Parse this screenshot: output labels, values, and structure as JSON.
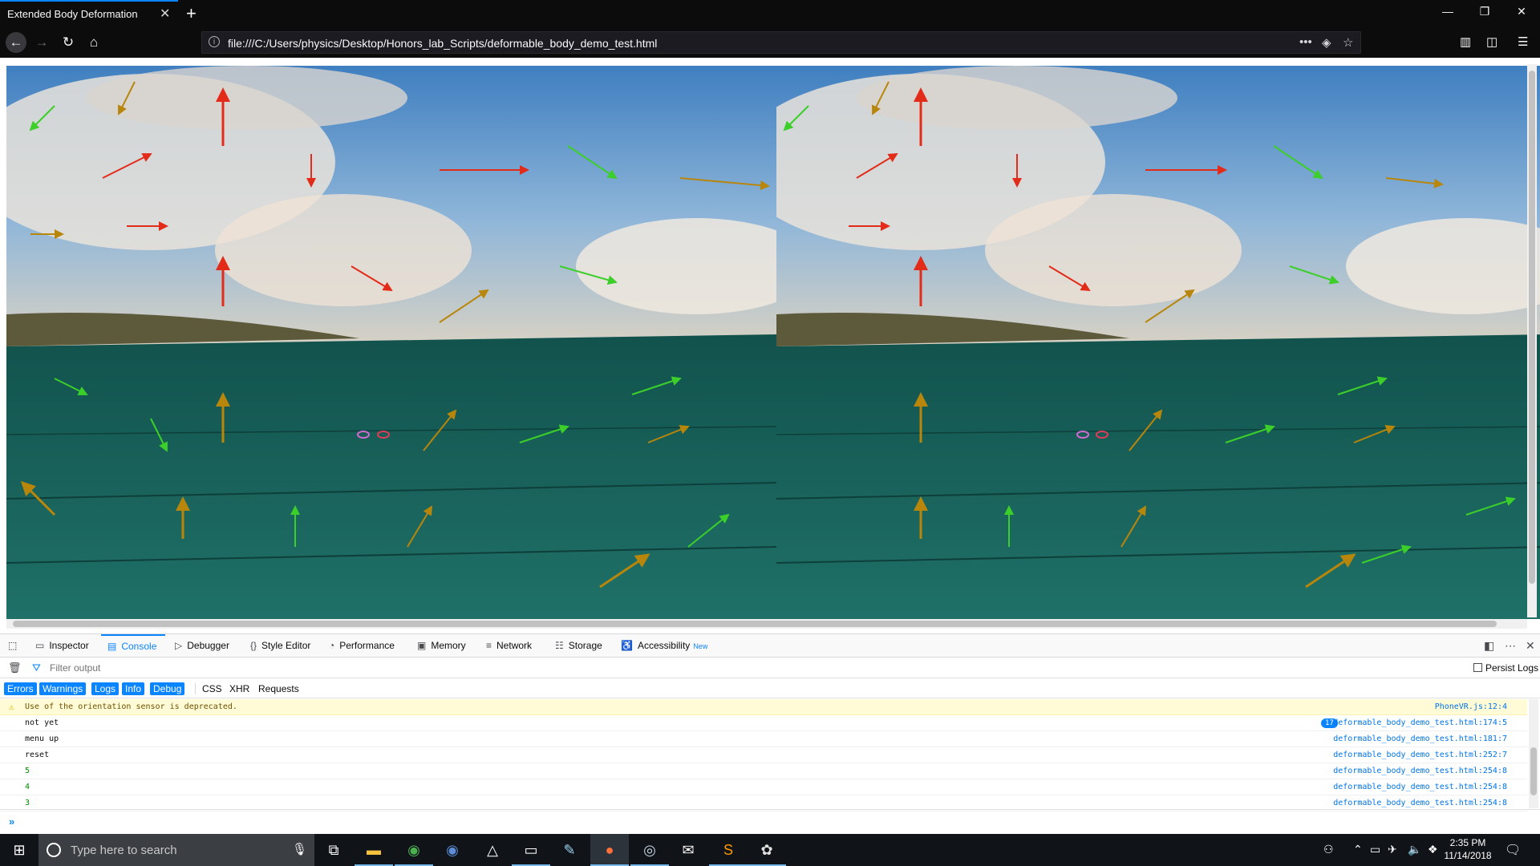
{
  "browser": {
    "tab_title": "Extended Body Deformation",
    "url": "file:///C:/Users/physics/Desktop/Honors_lab_Scripts/deformable_body_demo_test.html"
  },
  "devtools": {
    "tabs": [
      {
        "label": "Inspector",
        "icon": "inspector-icon"
      },
      {
        "label": "Console",
        "icon": "console-icon",
        "selected": true
      },
      {
        "label": "Debugger",
        "icon": "debugger-icon"
      },
      {
        "label": "Style Editor",
        "icon": "style-editor-icon"
      },
      {
        "label": "Performance",
        "icon": "performance-icon"
      },
      {
        "label": "Memory",
        "icon": "memory-icon"
      },
      {
        "label": "Network",
        "icon": "network-icon"
      },
      {
        "label": "Storage",
        "icon": "storage-icon"
      },
      {
        "label": "Accessibility",
        "icon": "accessibility-icon"
      }
    ],
    "accessibility_badge": "New",
    "filter_placeholder": "Filter output",
    "persist_logs_label": "Persist Logs",
    "levels": [
      {
        "label": "Errors",
        "on": true
      },
      {
        "label": "Warnings",
        "on": true
      },
      {
        "label": "Logs",
        "on": true
      },
      {
        "label": "Info",
        "on": true
      },
      {
        "label": "Debug",
        "on": true
      }
    ],
    "categories": [
      "CSS",
      "XHR",
      "Requests"
    ],
    "messages": [
      {
        "type": "warning",
        "text": "Use of the orientation sensor is deprecated.",
        "source": "PhoneVR.js:12:4"
      },
      {
        "type": "log",
        "text": "not yet",
        "source": "deformable_body_demo_test.html:174:5",
        "repeat": "17"
      },
      {
        "type": "log",
        "text": "menu up",
        "source": "deformable_body_demo_test.html:181:7"
      },
      {
        "type": "log",
        "text": "reset",
        "source": "deformable_body_demo_test.html:252:7"
      },
      {
        "type": "number",
        "text": "5",
        "source": "deformable_body_demo_test.html:254:8"
      },
      {
        "type": "number",
        "text": "4",
        "source": "deformable_body_demo_test.html:254:8"
      },
      {
        "type": "number",
        "text": "3",
        "source": "deformable_body_demo_test.html:254:8"
      }
    ],
    "prompt": "»"
  },
  "taskbar": {
    "search_placeholder": "Type here to search",
    "time": "2:35 PM",
    "date": "11/14/2018",
    "apps": [
      "task-view-icon",
      "file-explorer-icon",
      "chrome-icon",
      "chromium-icon",
      "drive-icon",
      "terminal-icon",
      "notepad-icon",
      "firefox-icon",
      "steam-icon",
      "mail-icon",
      "sublime-text-icon",
      "paint-icon"
    ]
  },
  "colors": {
    "accent": "#0a84ff",
    "arrow_green": "#3ccf2a",
    "arrow_red": "#e32b1a",
    "arrow_orange": "#b8860b",
    "floor": "#1e6b63"
  }
}
